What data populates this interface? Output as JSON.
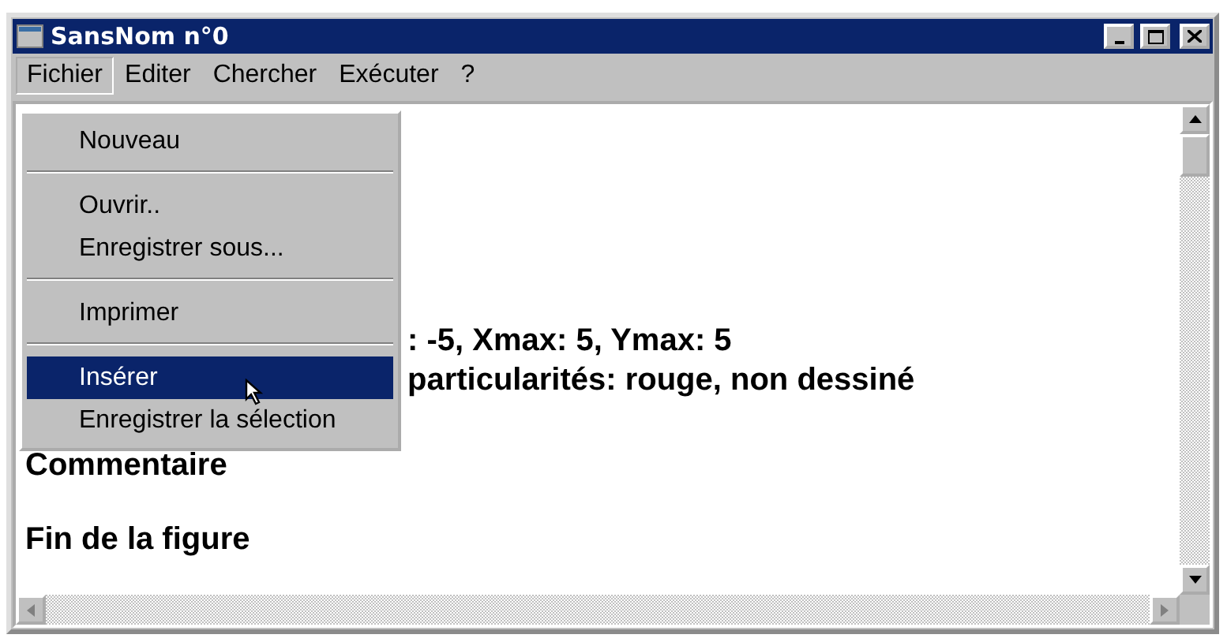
{
  "window": {
    "title": "SansNom n°0"
  },
  "menu_bar": [
    {
      "label": "Fichier",
      "selected": true
    },
    {
      "label": "Editer",
      "selected": false
    },
    {
      "label": "Chercher",
      "selected": false
    },
    {
      "label": "Exécuter",
      "selected": false
    },
    {
      "label": "?",
      "selected": false
    }
  ],
  "dropdown": [
    {
      "kind": "item",
      "label": "Nouveau",
      "selected": false
    },
    {
      "kind": "separator"
    },
    {
      "kind": "item",
      "label": "Ouvrir..",
      "selected": false
    },
    {
      "kind": "item",
      "label": "Enregistrer sous...",
      "selected": false
    },
    {
      "kind": "separator"
    },
    {
      "kind": "item",
      "label": "Imprimer",
      "selected": false
    },
    {
      "kind": "separator"
    },
    {
      "kind": "item",
      "label": "Insérer",
      "selected": true
    },
    {
      "kind": "item",
      "label": "Enregistrer la sélection",
      "selected": false
    }
  ],
  "document": {
    "lines": [
      {
        "text": ": -5, Xmax: 5, Ymax: 5"
      },
      {
        "text": " particularités: rouge, non dessiné"
      },
      {
        "text": "Commentaire"
      },
      {
        "text": "Fin de la figure"
      }
    ]
  }
}
